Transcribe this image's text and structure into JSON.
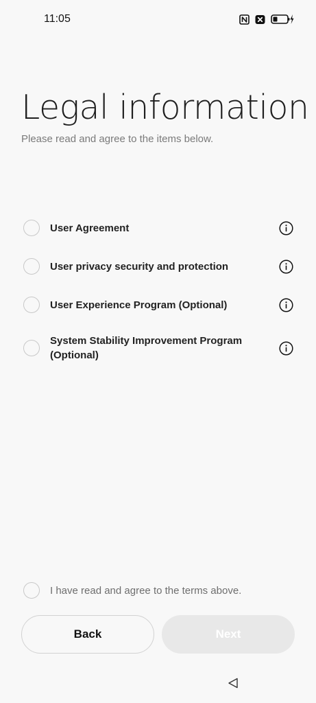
{
  "status_bar": {
    "time": "11:05",
    "icons": [
      "nfc-icon",
      "mute-icon",
      "battery-icon",
      "charging-icon"
    ]
  },
  "page": {
    "title": "Legal information",
    "subtitle": "Please read and agree to the items below."
  },
  "items": [
    {
      "label": "User Agreement",
      "checked": false,
      "icon": "info-icon"
    },
    {
      "label": "User privacy security and protection",
      "checked": false,
      "icon": "info-icon"
    },
    {
      "label": "User Experience Program (Optional)",
      "checked": false,
      "icon": "info-icon"
    },
    {
      "label": "System Stability Improvement Program (Optional)",
      "checked": false,
      "icon": "info-icon"
    }
  ],
  "agreement": {
    "label": "I have read and agree to the terms above.",
    "checked": false
  },
  "buttons": {
    "back_label": "Back",
    "next_label": "Next",
    "next_enabled": false
  },
  "nav_bar": {
    "back_icon": "triangle-back-icon"
  },
  "colors": {
    "background": "#f8f8f8",
    "next_disabled_bg": "#e8e8e8",
    "radio_border": "#c8c8c8"
  }
}
